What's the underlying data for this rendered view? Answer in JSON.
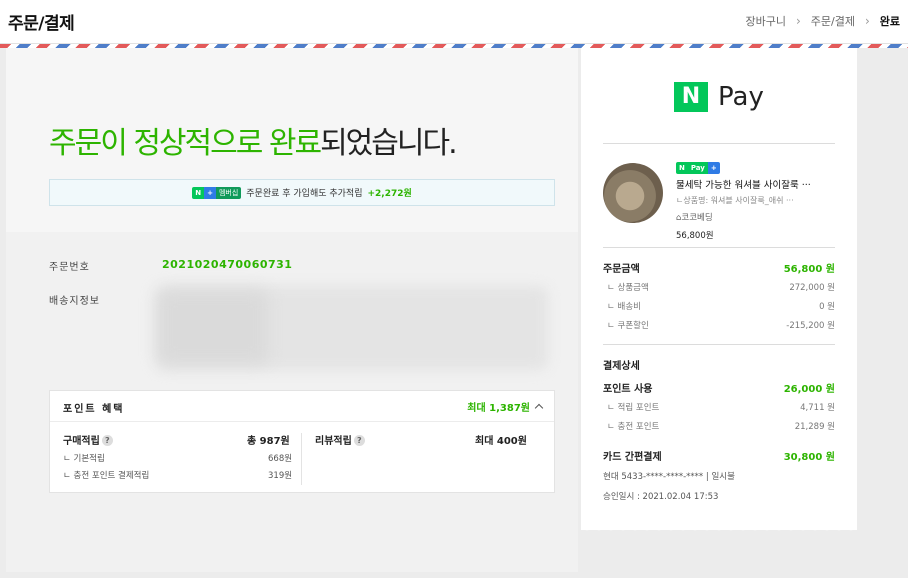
{
  "header": {
    "title": "주문/결제",
    "breadcrumb": [
      "장바구니",
      "주문/결제",
      "완료"
    ]
  },
  "hero": {
    "title_green_1": "주문이 정상적으로 완료",
    "title_rest": "되었습니다.",
    "notice_badge_n": "N",
    "notice_badge_plus": "+",
    "notice_badge_member": "멤버십",
    "notice_text": "주문완료 후 가입해도 추가적립",
    "notice_points": "+2,272원"
  },
  "order": {
    "number_label": "주문번호",
    "number": "2021020470060731",
    "shipping_label": "배송지정보"
  },
  "points": {
    "title": "포인트 혜택",
    "max": "최대 1,387원",
    "purchase_label": "구매적립",
    "purchase_total": "총 987원",
    "basic_label": "기본적립",
    "basic_value": "668원",
    "charge_label": "충전 포인트 결제적립",
    "charge_value": "319원",
    "review_label": "리뷰적립",
    "review_value": "최대 400원",
    "help": "?"
  },
  "receipt": {
    "logo_n": "N",
    "logo_word": "Pay",
    "product": {
      "badge_n": "N",
      "badge_pay": "Pay",
      "badge_plus": "+",
      "name": "물세탁 가능한 워셔블 사이잘룩 ···",
      "option": "ㄴ상품명: 워셔블 사이잘룩_애쉬 ···",
      "store": "⌂코코베딩",
      "price": "56,800원"
    },
    "order_amount_label": "주문금액",
    "order_amount": "56,800 원",
    "goods_label": "상품금액",
    "goods_value": "272,000 원",
    "ship_label": "배송비",
    "ship_value": "0 원",
    "coupon_label": "쿠폰할인",
    "coupon_value": "-215,200 원",
    "pay_detail_label": "결제상세",
    "point_use_label": "포인트 사용",
    "point_use_value": "26,000 원",
    "earned_label": "적립 포인트",
    "earned_value": "4,711 원",
    "charged_label": "충전 포인트",
    "charged_value": "21,289 원",
    "card_label": "카드 간편결제",
    "card_value": "30,800 원",
    "card_info": "현대 5433-****-****-**** | 일시불",
    "approved": "승인일시 : 2021.02.04 17:53"
  }
}
